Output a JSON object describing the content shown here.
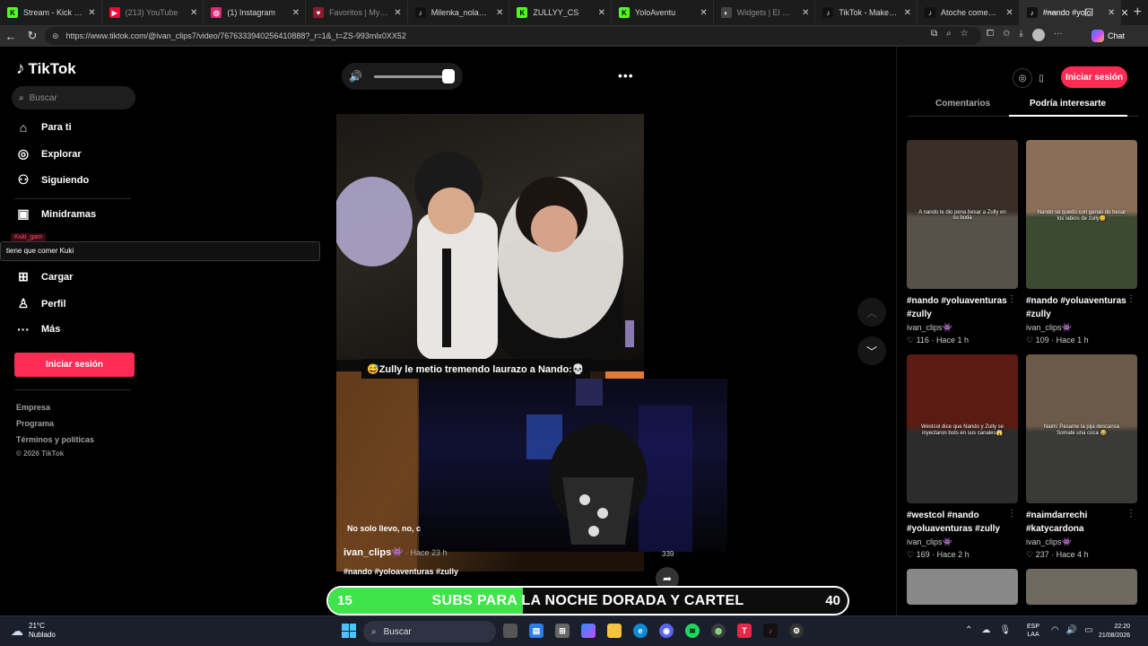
{
  "browser": {
    "tabs": [
      {
        "title": "Stream - Kick Dash",
        "fav_color": "#53fc18",
        "fav_glyph": "K",
        "dim": false
      },
      {
        "title": "(213) YouTube",
        "fav_color": "#ff0033",
        "fav_glyph": "▶",
        "dim": true
      },
      {
        "title": "(1) Instagram",
        "fav_color": "#d62976",
        "fav_glyph": "◎",
        "dim": false
      },
      {
        "title": "Favoritos | Myinsta",
        "fav_color": "#8b1a2f",
        "fav_glyph": "♥",
        "dim": true
      },
      {
        "title": "Milenka_nolasco",
        "fav_color": "#111111",
        "fav_glyph": "♪",
        "dim": false
      },
      {
        "title": "ZULLYY_CS",
        "fav_color": "#53fc18",
        "fav_glyph": "K",
        "dim": false
      },
      {
        "title": "YoloAventu",
        "fav_color": "#53fc18",
        "fav_glyph": "K",
        "dim": false
      },
      {
        "title": "Widgets | El mejor",
        "fav_color": "#444444",
        "fav_glyph": "◐",
        "dim": true
      },
      {
        "title": "TikTok - Make Your",
        "fav_color": "#111111",
        "fav_glyph": "♪",
        "dim": false
      },
      {
        "title": "Atoche comenta la",
        "fav_color": "#111111",
        "fav_glyph": "♪",
        "dim": false
      },
      {
        "title": "#nando #yolo",
        "fav_color": "#111111",
        "fav_glyph": "♪",
        "dim": false,
        "active": true
      }
    ],
    "url": "https://www.tiktok.com/@ivan_clips7/video/7676333940256410888?_r=1&_t=ZS-993mlx0XX52",
    "chat_label": "Chat"
  },
  "sidebar": {
    "brand": "TikTok",
    "search_placeholder": "Buscar",
    "nav": [
      {
        "label": "Para ti",
        "icon": "home-icon",
        "glyph": "⌂"
      },
      {
        "label": "Explorar",
        "icon": "compass-icon",
        "glyph": "◎"
      },
      {
        "label": "Siguiendo",
        "icon": "following-icon",
        "glyph": "⚇"
      },
      {
        "label": "Minidramas",
        "icon": "minidramas-icon",
        "glyph": "▣"
      },
      {
        "label": "Cargar",
        "icon": "upload-icon",
        "glyph": "⊞"
      },
      {
        "label": "Perfil",
        "icon": "profile-icon",
        "glyph": "♙"
      },
      {
        "label": "Más",
        "icon": "more-icon",
        "glyph": "···"
      }
    ],
    "login_label": "Iniciar sesión",
    "footer": [
      "Empresa",
      "Programa",
      "Términos y políticas",
      "© 2026 TikTok"
    ]
  },
  "overlay": {
    "sticker_user": "Kuki_gam",
    "sticker_text": "tiene que comer Kuki"
  },
  "player": {
    "volume_level": 0.92,
    "caption": "😅Zully le metio tremendo laurazo a Nando:💀",
    "video_text": "No solo llevo, no, c",
    "author": "ivan_clips👾",
    "time": "· Hace 23 h",
    "tags": "#nando #yoloaventuras #zully",
    "share_count": "339"
  },
  "right_panel": {
    "login_label": "Iniciar sesión",
    "tabs": [
      "Comentarios",
      "Podría interesarte"
    ],
    "cards": [
      {
        "title": "#nando #yoluaventuras #zully",
        "user": "ivan_clips👾",
        "likes": "116",
        "time": "Hace 1 h",
        "thumb_text": "A nando le dio pena besar a Zully en su boda",
        "bg_top": "#3a2f28",
        "bg_bottom": "#56524a"
      },
      {
        "title": "#nando #yoluaventuras #zully",
        "user": "ivan_clips👾",
        "likes": "109",
        "time": "Hace 1 h",
        "thumb_text": "Nando se quedo con ganas de besar los labios de zully😋",
        "bg_top": "#8a6e58",
        "bg_bottom": "#3d4a32"
      },
      {
        "title": "#westcol #nando #yoluaventuras #zully",
        "user": "ivan_clips👾",
        "likes": "169",
        "time": "Hace 2 h",
        "thumb_text": "Westcol dice que Nando y Zully se inyectaron bots en sus canales😱",
        "bg_top": "#5a1c12",
        "bg_bottom": "#2c2c2c"
      },
      {
        "title": "#naimdarrechi #katycardona",
        "user": "ivan_clips👾",
        "likes": "237",
        "time": "Hace 4 h",
        "thumb_text": "Naim: Pasame la pija descansa Somate una coca 😂",
        "bg_top": "#6b5a48",
        "bg_bottom": "#3a3a36"
      }
    ]
  },
  "subs_goal": {
    "current": "15",
    "label": "SUBS PARA LA NOCHE DORADA Y CARTEL",
    "target": "40",
    "progress": 0.375
  },
  "taskbar": {
    "weather_temp": "21°C",
    "weather_desc": "Nublado",
    "search_label": "Buscar",
    "lang": "ESP",
    "lang_sub": "LAA",
    "time": "22:20",
    "date": "21/08/2026"
  }
}
